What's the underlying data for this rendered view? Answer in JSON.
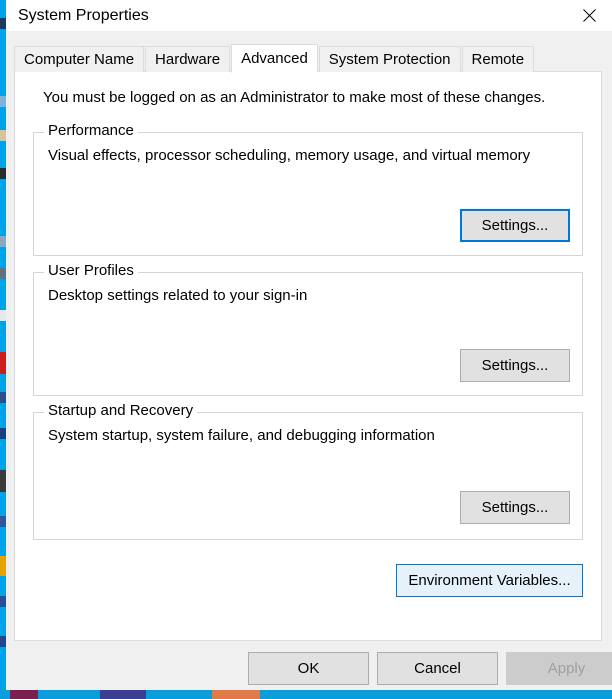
{
  "window": {
    "title": "System Properties",
    "close_icon": "close-x-icon"
  },
  "tabs": [
    {
      "label": "Computer Name",
      "selected": false
    },
    {
      "label": "Hardware",
      "selected": false
    },
    {
      "label": "Advanced",
      "selected": true
    },
    {
      "label": "System Protection",
      "selected": false
    },
    {
      "label": "Remote",
      "selected": false
    }
  ],
  "content": {
    "admin_note": "You must be logged on as an Administrator to make most of these changes.",
    "groups": [
      {
        "title": "Performance",
        "description": "Visual effects, processor scheduling, memory usage, and virtual memory",
        "button_label": "Settings...",
        "button_state": "focused"
      },
      {
        "title": "User Profiles",
        "description": "Desktop settings related to your sign-in",
        "button_label": "Settings...",
        "button_state": "normal"
      },
      {
        "title": "Startup and Recovery",
        "description": "System startup, system failure, and debugging information",
        "button_label": "Settings...",
        "button_state": "normal"
      }
    ],
    "env_vars_button": {
      "label": "Environment Variables...",
      "state": "hovered"
    }
  },
  "actions": {
    "ok": {
      "label": "OK",
      "state": "normal"
    },
    "cancel": {
      "label": "Cancel",
      "state": "normal"
    },
    "apply": {
      "label": "Apply",
      "state": "disabled"
    }
  },
  "colors": {
    "accent": "#0078d7",
    "hover_fill": "#e5f1fb",
    "dialog_bg": "#f0f0f0",
    "panel_bg": "#ffffff",
    "button_bg": "#e1e1e1",
    "button_border": "#adadad",
    "disabled_text": "#a0a0a0",
    "background_window_accent": "#00a2e8"
  }
}
